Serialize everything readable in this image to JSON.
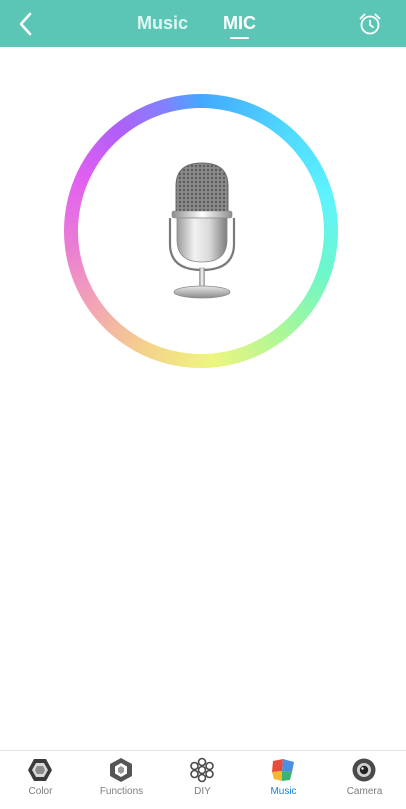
{
  "header": {
    "tabs": [
      {
        "label": "Music",
        "active": false
      },
      {
        "label": "MIC",
        "active": true
      }
    ],
    "back_icon": "chevron-left-icon",
    "alarm_icon": "alarm-clock-icon"
  },
  "main": {
    "icon": "microphone-icon"
  },
  "bottom_nav": {
    "items": [
      {
        "label": "Color",
        "icon": "color-icon",
        "active": false
      },
      {
        "label": "Functions",
        "icon": "functions-icon",
        "active": false
      },
      {
        "label": "DIY",
        "icon": "diy-icon",
        "active": false
      },
      {
        "label": "Music",
        "icon": "music-icon",
        "active": true
      },
      {
        "label": "Camera",
        "icon": "camera-icon",
        "active": false
      }
    ]
  },
  "colors": {
    "header_bg": "#5cc6b6",
    "active_nav": "#1a82d6",
    "inactive_nav": "#7d7d7d"
  }
}
